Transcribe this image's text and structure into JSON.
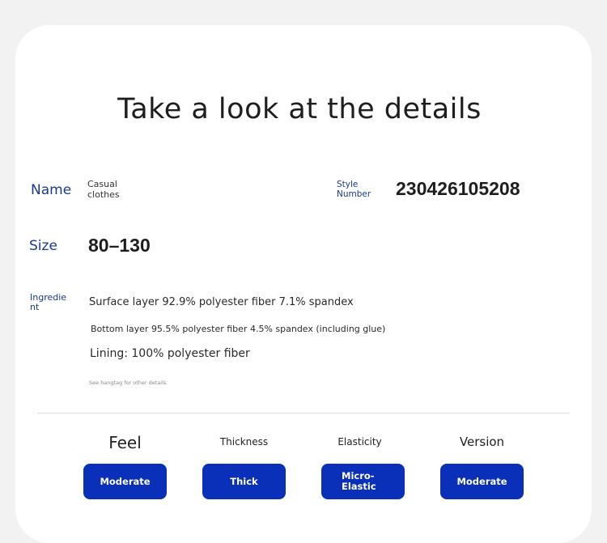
{
  "title": "Take a look at the details",
  "name": {
    "label": "Name",
    "value": "Casual clothes"
  },
  "style_number": {
    "label": "Style Number",
    "value": "230426105208"
  },
  "size": {
    "label": "Size",
    "value": "80–130"
  },
  "ingredient": {
    "label": "Ingredient",
    "lines": [
      "Surface layer 92.9% polyester fiber 7.1% spandex",
      "Bottom layer 95.5% polyester fiber 4.5% spandex (including glue)",
      "Lining: 100% polyester fiber"
    ],
    "note": "See hangtag for other details"
  },
  "attributes": [
    {
      "heading": "Feel",
      "value": "Moderate"
    },
    {
      "heading": "Thickness",
      "value": "Thick"
    },
    {
      "heading": "Elasticity",
      "value": "Micro-Elastic"
    },
    {
      "heading": "Version",
      "value": "Moderate"
    }
  ],
  "colors": {
    "accent": "#0a2fb8",
    "label_blue": "#1a3a8f",
    "background": "#f2f2f2",
    "card": "#ffffff"
  }
}
